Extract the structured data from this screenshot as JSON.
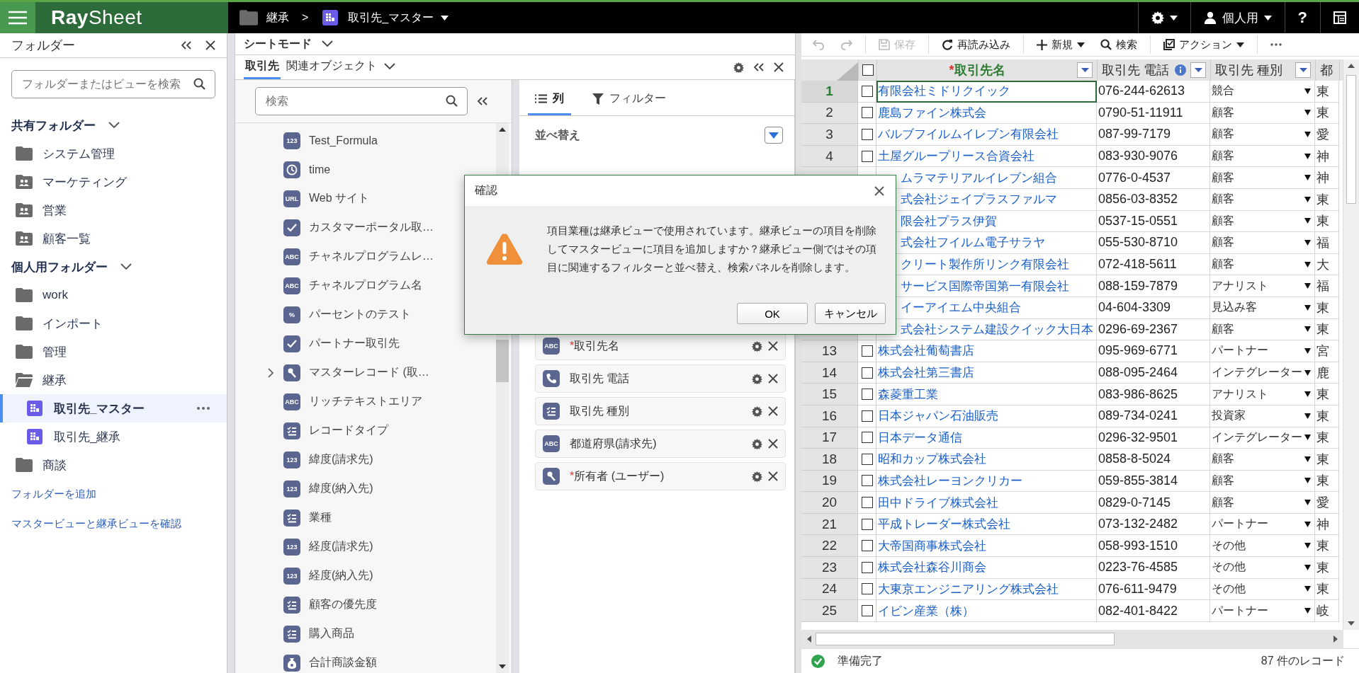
{
  "header": {
    "logo": "**Ray**Sheet",
    "breadcrumb": [
      {
        "label": "継承",
        "kind": "folder",
        "dropdown": false
      },
      {
        "label": "取引先_マスター",
        "kind": "view",
        "dropdown": true
      }
    ],
    "separator": ">",
    "user": "個人用",
    "help": "?"
  },
  "sidebar": {
    "title": "フォルダー",
    "search": {
      "placeholder": "フォルダーまたはビューを検索"
    },
    "sections": [
      {
        "title": "共有フォルダー",
        "expanded": true,
        "items": [
          {
            "label": "システム管理",
            "kind": "folder",
            "expanded": false
          },
          {
            "label": "マーケティング",
            "kind": "shared"
          },
          {
            "label": "営業",
            "kind": "shared"
          },
          {
            "label": "顧客一覧",
            "kind": "shared"
          }
        ]
      },
      {
        "title": "個人用フォルダー",
        "expanded": true,
        "items": [
          {
            "label": "work",
            "kind": "folder",
            "expanded": false
          },
          {
            "label": "インポート",
            "kind": "folder",
            "expanded": false
          },
          {
            "label": "管理",
            "kind": "folder",
            "expanded": false
          },
          {
            "label": "継承",
            "kind": "folder",
            "expanded": true,
            "children": [
              {
                "label": "取引先_マスター",
                "kind": "view",
                "selected": true
              },
              {
                "label": "取引先_継承",
                "kind": "view",
                "selected": false
              }
            ]
          },
          {
            "label": "商談",
            "kind": "folder",
            "expanded": false
          }
        ]
      }
    ],
    "links": [
      "フォルダーを追加",
      "マスタービューと継承ビューを確認"
    ]
  },
  "mode": {
    "label": "シートモード"
  },
  "object_tabs": [
    {
      "label": "取引先",
      "selected": true,
      "dropdown": false
    },
    {
      "label": "関連オブジェクト",
      "selected": false,
      "dropdown": true
    }
  ],
  "fields": {
    "search": {
      "placeholder": "検索"
    },
    "items": [
      {
        "label": "Test_Formula",
        "kind": "number",
        "badge": "123",
        "expandable": false
      },
      {
        "label": "time",
        "kind": "time",
        "expandable": false
      },
      {
        "label": "Web サイト",
        "kind": "url",
        "badge": "URL",
        "expandable": false
      },
      {
        "label": "カスタマーポータル取…",
        "kind": "checkbox",
        "expandable": false
      },
      {
        "label": "チャネルプログラムレ…",
        "kind": "text",
        "badge": "ABC",
        "expandable": false
      },
      {
        "label": "チャネルプログラム名",
        "kind": "text",
        "badge": "ABC",
        "expandable": false
      },
      {
        "label": "パーセントのテスト",
        "kind": "percent",
        "badge": "%",
        "expandable": false
      },
      {
        "label": "パートナー取引先",
        "kind": "checkbox",
        "expandable": false
      },
      {
        "label": "マスターレコード (取…",
        "kind": "lookup",
        "expandable": true
      },
      {
        "label": "リッチテキストエリア",
        "kind": "text",
        "badge": "ABC",
        "expandable": false
      },
      {
        "label": "レコードタイプ",
        "kind": "picklist",
        "expandable": false
      },
      {
        "label": "緯度(請求先)",
        "kind": "number",
        "badge": "123",
        "expandable": false
      },
      {
        "label": "緯度(納入先)",
        "kind": "number",
        "badge": "123",
        "expandable": false
      },
      {
        "label": "業種",
        "kind": "picklist",
        "expandable": false
      },
      {
        "label": "経度(請求先)",
        "kind": "number",
        "badge": "123",
        "expandable": false
      },
      {
        "label": "経度(納入先)",
        "kind": "number",
        "badge": "123",
        "expandable": false
      },
      {
        "label": "顧客の優先度",
        "kind": "picklist",
        "expandable": false
      },
      {
        "label": "購入商品",
        "kind": "picklist",
        "expandable": false
      },
      {
        "label": "合計商談金額",
        "kind": "currency",
        "expandable": false
      }
    ]
  },
  "settings_tabs": [
    {
      "label": "列",
      "kind": "columns",
      "selected": true
    },
    {
      "label": "フィルター",
      "kind": "filter",
      "selected": false
    }
  ],
  "sort": {
    "title": "並べ替え"
  },
  "columns_list": [
    {
      "label": "取引先名",
      "mark": "*",
      "kind": "text",
      "badge": "ABC"
    },
    {
      "label": "取引先 電話",
      "kind": "phone"
    },
    {
      "label": "取引先 種別",
      "kind": "picklist"
    },
    {
      "label": "都道府県(請求先)",
      "kind": "text",
      "badge": "ABC"
    },
    {
      "label": "所有者 (ユーザー)",
      "mark": "*",
      "kind": "lookup"
    }
  ],
  "toolbar": [
    {
      "kind": "undo",
      "disabled": true,
      "dropdown": false
    },
    {
      "kind": "redo",
      "disabled": true,
      "dropdown": false
    },
    {
      "kind": "save",
      "label": "保存",
      "disabled": true,
      "dropdown": false
    },
    {
      "kind": "reload",
      "label": "再読み込み",
      "disabled": false,
      "dropdown": false
    },
    {
      "kind": "new",
      "label": "新規",
      "disabled": false,
      "dropdown": true
    },
    {
      "kind": "search",
      "label": "検索",
      "disabled": false,
      "dropdown": false
    },
    {
      "kind": "action",
      "label": "アクション",
      "disabled": false,
      "dropdown": true
    },
    {
      "kind": "more",
      "disabled": false,
      "dropdown": false
    }
  ],
  "table": {
    "select_all_checked": false,
    "columns": [
      {
        "label": "取引先名",
        "mark": "*",
        "info": false,
        "filter": true
      },
      {
        "label": "取引先 電話",
        "info": true,
        "filter": true
      },
      {
        "label": "取引先 種別",
        "info": false,
        "filter": true
      },
      {
        "label": "都"
      }
    ],
    "rows": [
      {
        "row_number": "1",
        "checked": false,
        "selected": true,
        "name": "有限会社ミドリクイック",
        "phone": "076-244-62613",
        "type": "競合",
        "column_4": "東"
      },
      {
        "row_number": "2",
        "checked": false,
        "selected": false,
        "name": "鹿島ファイン株式会",
        "phone": "0790-51-11911",
        "type": "顧客",
        "column_4": "東"
      },
      {
        "row_number": "3",
        "checked": false,
        "selected": false,
        "name": "バルブフイルムイレブン有限会社",
        "phone": "087-99-7179",
        "type": "顧客",
        "column_4": "愛"
      },
      {
        "row_number": "4",
        "checked": false,
        "selected": false,
        "name": "土屋グループリース合資会社",
        "phone": "083-930-9076",
        "type": "顧客",
        "column_4": "神"
      },
      {
        "name": "ムラマテリアルイレブン組合",
        "phone": "0776-0-4537",
        "type": "顧客",
        "column_4": "神"
      },
      {
        "name": "式会社ジェイプラスファルマ",
        "phone": "0856-03-8352",
        "type": "顧客",
        "column_4": "東"
      },
      {
        "name": "限会社プラス伊賀",
        "phone": "0537-15-0551",
        "type": "顧客",
        "column_4": "東"
      },
      {
        "name": "式会社フイルム電子サラヤ",
        "phone": "055-530-8710",
        "type": "顧客",
        "column_4": "福"
      },
      {
        "name": "クリート製作所リンク有限会社",
        "phone": "072-418-5611",
        "type": "顧客",
        "column_4": "大"
      },
      {
        "name": "サービス国際帝国第一有限会社",
        "phone": "088-159-7879",
        "type": "アナリスト",
        "column_4": "福"
      },
      {
        "name": "イーアイエム中央組合",
        "phone": "04-604-3309",
        "type": "見込み客",
        "column_4": "東"
      },
      {
        "name": "式会社システム建設クイック大日本",
        "phone": "0296-69-2367",
        "type": "顧客",
        "column_4": "東"
      },
      {
        "row_number": "13",
        "checked": false,
        "selected": false,
        "name": "株式会社葡萄書店",
        "phone": "095-969-6771",
        "type": "パートナー",
        "column_4": "宮"
      },
      {
        "row_number": "14",
        "checked": false,
        "selected": false,
        "name": "株式会社第三書店",
        "phone": "088-095-2464",
        "type": "インテグレーター",
        "column_4": "鹿"
      },
      {
        "row_number": "15",
        "checked": false,
        "selected": false,
        "name": "森菱重工業",
        "phone": "083-986-8625",
        "type": "アナリスト",
        "column_4": "東"
      },
      {
        "row_number": "16",
        "checked": false,
        "selected": false,
        "name": "日本ジャパン石油販売",
        "phone": "089-734-0241",
        "type": "投資家",
        "column_4": "東"
      },
      {
        "row_number": "17",
        "checked": false,
        "selected": false,
        "name": "日本データ通信",
        "phone": "0296-32-9501",
        "type": "インテグレーター",
        "column_4": "東"
      },
      {
        "row_number": "18",
        "checked": false,
        "selected": false,
        "name": "昭和カップ株式会社",
        "phone": "0858-8-5024",
        "type": "顧客",
        "column_4": "東"
      },
      {
        "row_number": "19",
        "checked": false,
        "selected": false,
        "name": "株式会社レーヨンクリカー",
        "phone": "059-855-3814",
        "type": "顧客",
        "column_4": "東"
      },
      {
        "row_number": "20",
        "checked": false,
        "selected": false,
        "name": "田中ドライブ株式会社",
        "phone": "0829-0-7145",
        "type": "顧客",
        "column_4": "愛"
      },
      {
        "row_number": "21",
        "checked": false,
        "selected": false,
        "name": "平成トレーダー株式会社",
        "phone": "073-132-2482",
        "type": "パートナー",
        "column_4": "神"
      },
      {
        "row_number": "22",
        "checked": false,
        "selected": false,
        "name": "大帝国商事株式会社",
        "phone": "058-993-1510",
        "type": "その他",
        "column_4": "東"
      },
      {
        "row_number": "23",
        "checked": false,
        "selected": false,
        "name": "株式会社森谷川商会",
        "phone": "0223-76-4585",
        "type": "その他",
        "column_4": "東"
      },
      {
        "row_number": "24",
        "checked": false,
        "selected": false,
        "name": "大東京エンジニアリング株式会社",
        "phone": "076-611-9479",
        "type": "その他",
        "column_4": "東"
      },
      {
        "row_number": "25",
        "checked": false,
        "selected": false,
        "name": "イビン産業（株）",
        "phone": "082-401-8422",
        "type": "パートナー",
        "column_4": "岐"
      }
    ]
  },
  "status_bar": {
    "status": "準備完了",
    "ok": true,
    "count": "87 件のレコード"
  },
  "dialog": {
    "title": "確認",
    "kind": "warning",
    "message": "項目業種は継承ビューで使用されています。継承ビューの項目を削除してマスタービューに項目を追加しますか？継承ビュー側ではその項目に関連するフィルターと並べ替え、検索パネルを削除します。",
    "buttons": [
      "OK",
      "キャンセル"
    ]
  }
}
